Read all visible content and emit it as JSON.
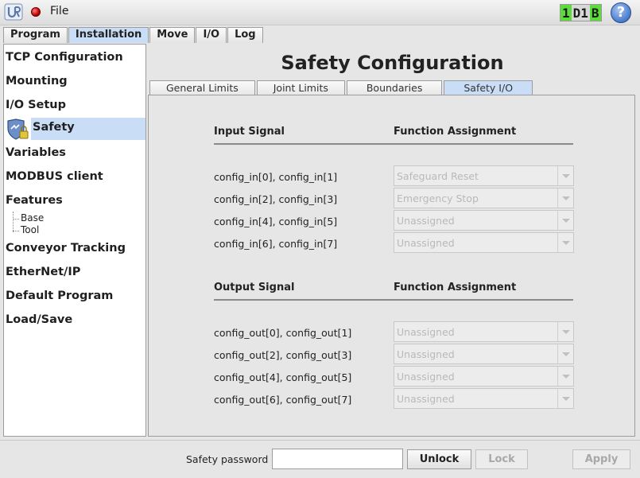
{
  "titlebar": {
    "file_label": "File",
    "robot_id": [
      "1",
      "D1",
      "B"
    ],
    "help_glyph": "?"
  },
  "top_tabs": [
    "Program",
    "Installation",
    "Move",
    "I/O",
    "Log"
  ],
  "active_top_tab": "Installation",
  "sidebar": {
    "items": [
      "TCP Configuration",
      "Mounting",
      "I/O Setup",
      "Safety",
      "Variables",
      "MODBUS client",
      "Features",
      "Conveyor Tracking",
      "EtherNet/IP",
      "Default Program",
      "Load/Save"
    ],
    "selected": "Safety",
    "feature_children": [
      "Base",
      "Tool"
    ]
  },
  "main": {
    "title": "Safety Configuration",
    "tabs": [
      "General Limits",
      "Joint Limits",
      "Boundaries",
      "Safety I/O"
    ],
    "active_tab": "Safety I/O",
    "input": {
      "heading_signal": "Input Signal",
      "heading_assignment": "Function Assignment",
      "rows": [
        {
          "signal": "config_in[0], config_in[1]",
          "assignment": "Safeguard Reset"
        },
        {
          "signal": "config_in[2], config_in[3]",
          "assignment": "Emergency Stop"
        },
        {
          "signal": "config_in[4], config_in[5]",
          "assignment": "Unassigned"
        },
        {
          "signal": "config_in[6], config_in[7]",
          "assignment": "Unassigned"
        }
      ]
    },
    "output": {
      "heading_signal": "Output Signal",
      "heading_assignment": "Function Assignment",
      "rows": [
        {
          "signal": "config_out[0], config_out[1]",
          "assignment": "Unassigned"
        },
        {
          "signal": "config_out[2], config_out[3]",
          "assignment": "Unassigned"
        },
        {
          "signal": "config_out[4], config_out[5]",
          "assignment": "Unassigned"
        },
        {
          "signal": "config_out[6], config_out[7]",
          "assignment": "Unassigned"
        }
      ]
    }
  },
  "bottom": {
    "password_label": "Safety password",
    "password_value": "",
    "unlock": "Unlock",
    "lock": "Lock",
    "apply": "Apply"
  },
  "colors": {
    "selection": "#c9ddf6",
    "robot_badge_green": "#5bdc3a",
    "disabled_text": "#b9b9b9"
  }
}
